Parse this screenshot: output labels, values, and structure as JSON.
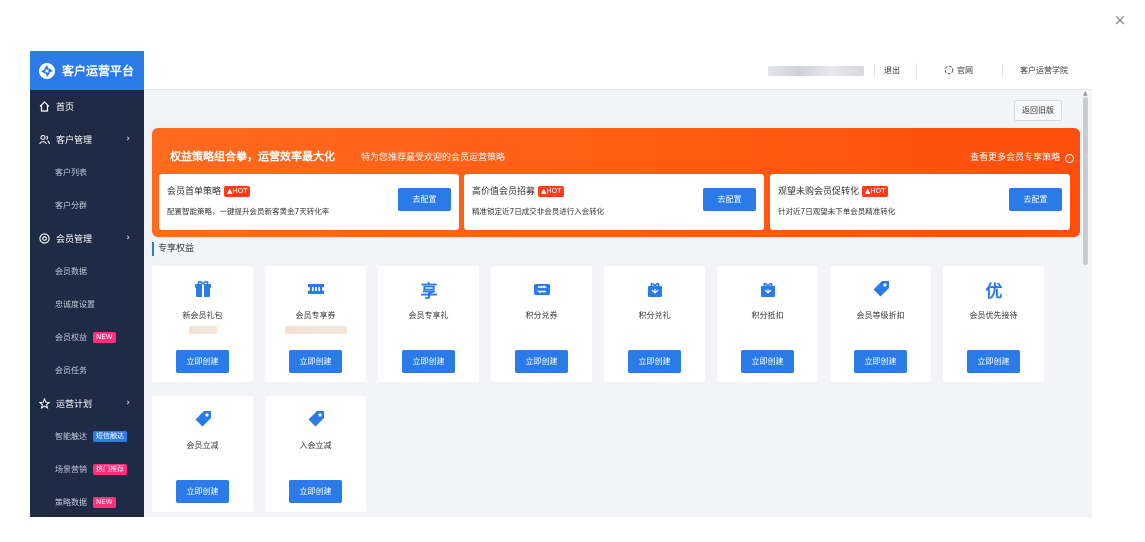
{
  "close_label": "×",
  "sidebar": {
    "brand": "客户运营平台",
    "items": [
      {
        "label": "首页",
        "icon": "home-icon"
      },
      {
        "label": "客户管理",
        "icon": "users-icon",
        "chevron": "›"
      },
      {
        "label": "客户列表",
        "sub": true
      },
      {
        "label": "客户分群",
        "sub": true
      },
      {
        "label": "会员管理",
        "icon": "member-icon",
        "chevron": "›"
      },
      {
        "label": "会员数据",
        "sub": true
      },
      {
        "label": "忠诚度设置",
        "sub": true
      },
      {
        "label": "会员权益",
        "sub": true,
        "tag": "NEW",
        "tag_color": "#ff2e7a"
      },
      {
        "label": "会员任务",
        "sub": true
      },
      {
        "label": "运营计划",
        "icon": "star-icon",
        "chevron": "›"
      },
      {
        "label": "智能触达",
        "sub": true,
        "tag": "短信触达",
        "tag_color": "#2a7be8"
      },
      {
        "label": "场景营销",
        "sub": true,
        "tag": "热门推荐",
        "tag_color": "#ff2e7a"
      },
      {
        "label": "策略数据",
        "sub": true,
        "tag": "NEW",
        "tag_color": "#ff2e7a"
      }
    ]
  },
  "topbar": {
    "logout": "退出",
    "official_site": "官网",
    "academy": "客户运营学院"
  },
  "back_button": "返回旧版",
  "banner": {
    "title": "权益策略组合拳，运营效率最大化",
    "subtitle": "特为您推荐最受欢迎的会员运营策略",
    "more": "查看更多会员专享策略",
    "more_icon": "›",
    "hot_label": "HOT",
    "cards": [
      {
        "name": "会员首单策略",
        "desc": "配置智能策略，一键提升会员新客黄金7天转化率",
        "button": "去配置"
      },
      {
        "name": "高价值会员招募",
        "desc": "精准锁定近7日成交非会员进行入会转化",
        "button": "去配置"
      },
      {
        "name": "观望未购会员促转化",
        "desc": "针对近7日观望未下单会员精准转化",
        "button": "去配置"
      }
    ]
  },
  "section_title": "专享权益",
  "benefits": [
    {
      "label": "新会员礼包",
      "icon": "gift-icon",
      "button": "立即创建",
      "glyph": ""
    },
    {
      "label": "会员专享券",
      "icon": "ticket-icon",
      "button": "立即创建",
      "glyph": ""
    },
    {
      "label": "会员专享礼",
      "icon": "enjoy-icon",
      "button": "立即创建",
      "glyph": "享"
    },
    {
      "label": "积分兑券",
      "icon": "coupon-icon",
      "button": "立即创建",
      "glyph": ""
    },
    {
      "label": "积分兑礼",
      "icon": "points-gift-icon",
      "button": "立即创建",
      "glyph": ""
    },
    {
      "label": "积分抵扣",
      "icon": "points-deduct-icon",
      "button": "立即创建",
      "glyph": ""
    },
    {
      "label": "会员等级折扣",
      "icon": "tag-icon",
      "button": "立即创建",
      "glyph": ""
    },
    {
      "label": "会员优先接待",
      "icon": "priority-icon",
      "button": "立即创建",
      "glyph": "优"
    },
    {
      "label": "会员立减",
      "icon": "tag-icon",
      "button": "立即创建",
      "glyph": ""
    },
    {
      "label": "入会立减",
      "icon": "tag-icon",
      "button": "立即创建",
      "glyph": ""
    }
  ],
  "colors": {
    "accent": "#2a7be8",
    "sidebar_bg": "#1f2a45",
    "banner_orange": "#ff5a12",
    "hot_red": "#ff3b18",
    "tag_pink": "#ff2e7a"
  }
}
